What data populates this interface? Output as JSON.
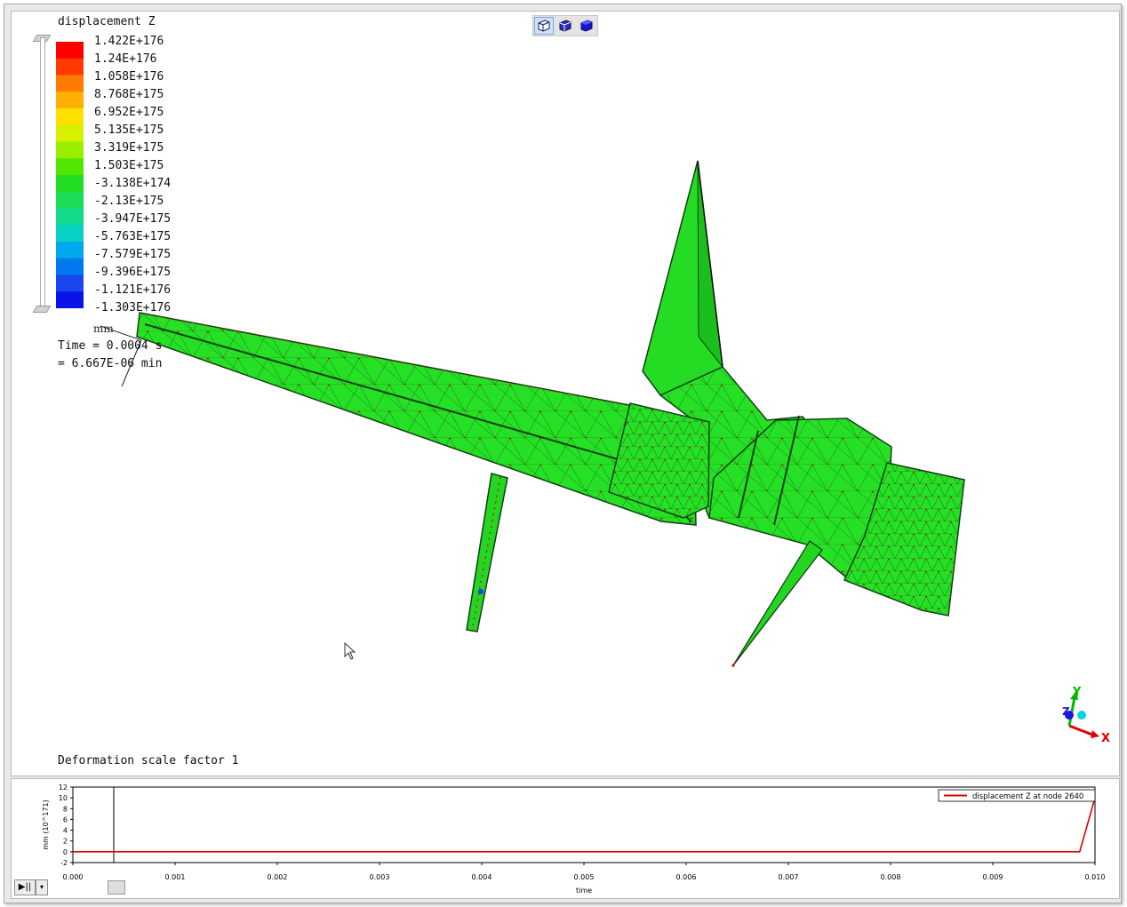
{
  "legend": {
    "title": "displacement Z",
    "values": [
      "1.422E+176",
      "1.24E+176",
      "1.058E+176",
      "8.768E+175",
      "6.952E+175",
      "5.135E+175",
      "3.319E+175",
      "1.503E+175",
      "-3.138E+174",
      "-2.13E+175",
      "-3.947E+175",
      "-5.763E+175",
      "-7.579E+175",
      "-9.396E+175",
      "-1.121E+176",
      "-1.303E+176"
    ],
    "colors": [
      "#ff0000",
      "#ff3a00",
      "#ff7a00",
      "#ffb000",
      "#ffe000",
      "#d7f000",
      "#9aee00",
      "#52e600",
      "#22dd22",
      "#1cdc56",
      "#12d98c",
      "#08d2c6",
      "#00a8ee",
      "#0078f0",
      "#1c46f0",
      "#0a14e6"
    ],
    "unit": "mm"
  },
  "time": {
    "line1": "Time = 0.0004 s",
    "line2": "= 6.667E-06 min"
  },
  "deformation_label": "Deformation scale factor 1",
  "view_buttons": [
    "wireframe-view",
    "shaded-view",
    "solid-view"
  ],
  "axes": {
    "x": "X",
    "y": "Y",
    "z": "Z"
  },
  "colors": {
    "mesh_fill": "#27e427",
    "mesh_edge": "#e00000",
    "plot_line": "#e00000"
  },
  "chart_data": {
    "type": "line",
    "xlabel": "time",
    "ylabel": "mm (10^171)",
    "xlim": [
      0.0,
      0.01
    ],
    "ylim": [
      -2,
      12
    ],
    "x_ticks": [
      "0.000",
      "0.001",
      "0.002",
      "0.003",
      "0.004",
      "0.005",
      "0.006",
      "0.007",
      "0.008",
      "0.009",
      "0.010"
    ],
    "y_ticks": [
      "12",
      "10",
      "8",
      "6",
      "4",
      "2",
      "0",
      "-2"
    ],
    "cursor_time": 0.0004,
    "series": [
      {
        "name": "displacement Z at node 2640",
        "x": [
          0.0,
          0.0098,
          0.00985,
          0.01
        ],
        "y": [
          0,
          0,
          0,
          10
        ]
      }
    ]
  },
  "controls": {
    "play_pause": "▶||",
    "dropdown": "▾"
  }
}
